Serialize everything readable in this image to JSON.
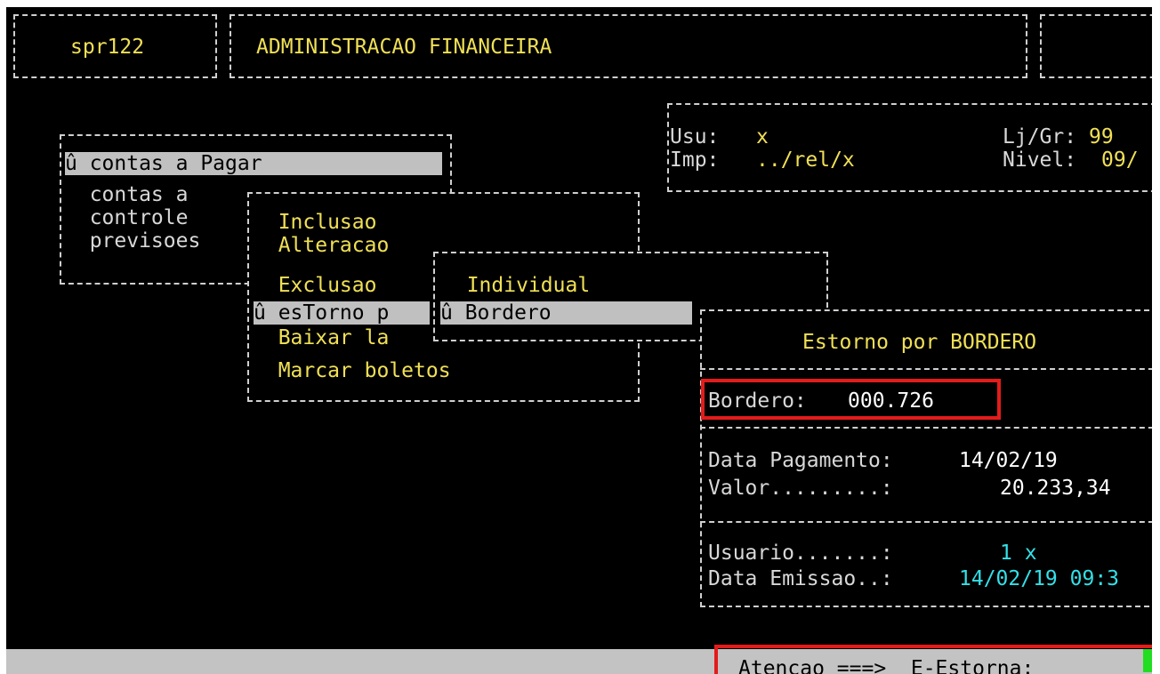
{
  "header": {
    "program_id": "spr122",
    "title": "ADMINISTRACAO FINANCEIRA"
  },
  "user_info": {
    "usu_label": "Usu:",
    "usu_value": "x",
    "imp_label": "Imp:",
    "imp_value": "../rel/x",
    "ljgr_label": "Lj/Gr:",
    "ljgr_value": "99",
    "nivel_label": "Nivel:",
    "nivel_value": "09/"
  },
  "menu1": {
    "items": [
      {
        "label": "û contas a Pagar"
      },
      {
        "label": "  contas a"
      },
      {
        "label": "  controle"
      },
      {
        "label": "  previsoes"
      }
    ]
  },
  "menu2": {
    "items": [
      {
        "label": "  Inclusao"
      },
      {
        "label": "  Alteracao"
      },
      {
        "label": "  Exclusao"
      },
      {
        "label": "û esTorno p"
      },
      {
        "label": "  Baixar la"
      },
      {
        "label": "  Marcar boletos"
      }
    ]
  },
  "menu3": {
    "items": [
      {
        "label": "  Individual"
      },
      {
        "label": "û Bordero"
      }
    ]
  },
  "dialog": {
    "title": "Estorno por BORDERO",
    "bordero_label": "Bordero:",
    "bordero_value": "000.726",
    "data_pagamento_label": "Data Pagamento:",
    "data_pagamento_value": "14/02/19",
    "valor_label": "Valor.........:",
    "valor_value": "20.233,34",
    "usuario_label": "Usuario.......:",
    "usuario_value": "1 x",
    "data_emissao_label": "Data Emissao..:",
    "data_emissao_value": "14/02/19 09:3"
  },
  "status": {
    "text": "Atencao ===>  E-Estorna:"
  },
  "colors": {
    "accent_yellow": "#f0e055",
    "accent_cyan": "#33e0e8",
    "highlight_red": "#e41b1b",
    "cursor_green": "#22dd22"
  }
}
